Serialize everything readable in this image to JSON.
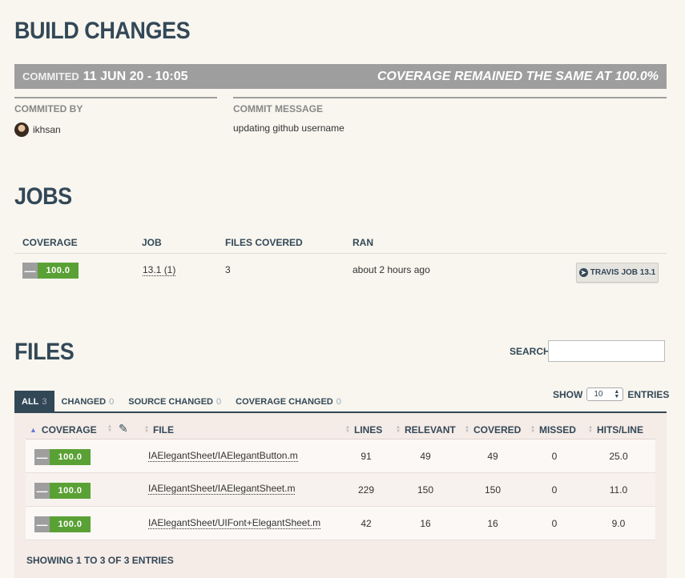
{
  "build": {
    "title": "BUILD CHANGES",
    "commit_label": "COMMITED",
    "commit_date": "11 JUN 20 - 10:05",
    "coverage_note": "COVERAGE REMAINED THE SAME AT 100.0%",
    "committed_by_label": "COMMITED BY",
    "committer": "ikhsan",
    "commit_message_label": "COMMIT MESSAGE",
    "commit_message": "updating github username"
  },
  "jobs": {
    "title": "JOBS",
    "headers": [
      "COVERAGE",
      "JOB",
      "FILES COVERED",
      "RAN"
    ],
    "row": {
      "coverage": "100.0",
      "job": "13.1 (1)",
      "files_covered": "3",
      "ran": "about 2 hours ago",
      "button": "TRAVIS JOB 13.1"
    }
  },
  "files": {
    "title": "FILES",
    "search_label": "SEARCH:",
    "search_value": "",
    "tabs": [
      {
        "label": "ALL",
        "count": "3"
      },
      {
        "label": "CHANGED",
        "count": "0"
      },
      {
        "label": "SOURCE CHANGED",
        "count": "0"
      },
      {
        "label": "COVERAGE CHANGED",
        "count": "0"
      }
    ],
    "show_label": "SHOW",
    "show_value": "10",
    "entries_label": "ENTRIES",
    "headers": [
      "COVERAGE",
      "FILE",
      "LINES",
      "RELEVANT",
      "COVERED",
      "MISSED",
      "HITS/LINE"
    ],
    "rows": [
      {
        "coverage": "100.0",
        "file": "IAElegantSheet/IAElegantButton.m",
        "lines": "91",
        "relevant": "49",
        "covered": "49",
        "missed": "0",
        "hits": "25.0"
      },
      {
        "coverage": "100.0",
        "file": "IAElegantSheet/IAElegantSheet.m",
        "lines": "229",
        "relevant": "150",
        "covered": "150",
        "missed": "0",
        "hits": "11.0"
      },
      {
        "coverage": "100.0",
        "file": "IAElegantSheet/UIFont+ElegantSheet.m",
        "lines": "42",
        "relevant": "16",
        "covered": "16",
        "missed": "0",
        "hits": "9.0"
      }
    ],
    "showing": "SHOWING 1 TO 3 OF 3 ENTRIES"
  },
  "colors": {
    "accent": "#334857",
    "covered_green": "#5aa135",
    "bar_gray": "#9e9e9e"
  }
}
